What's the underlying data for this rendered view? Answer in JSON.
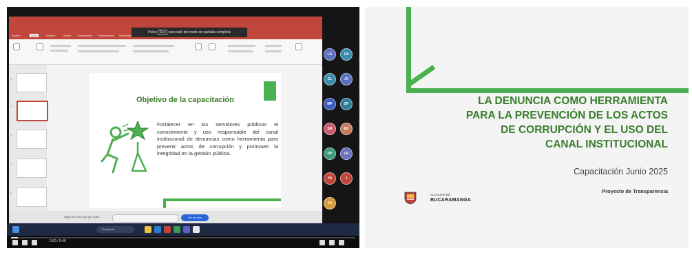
{
  "call": {
    "notice_prefix": "Pulse",
    "notice_key": "Esc",
    "notice_suffix": "para salir del modo de pantalla completa",
    "elapsed_time": "0:00 / 0:46",
    "progress_fraction": 0.02
  },
  "powerpoint": {
    "tabs": [
      "Archivo",
      "Inicio",
      "Insertar",
      "Diseño",
      "Transiciones",
      "Animaciones",
      "Presentación",
      "Revisar",
      "Vista"
    ],
    "accent": "#c0453a",
    "zoom_hint": "Haga clic para agregar notas",
    "button_label": "Ver en vivo",
    "search_placeholder": "Búsqueda"
  },
  "slide": {
    "title": "Objetivo de la capacitación",
    "body": "Fortalecer en los servidores públicos el conocimiento y uso responsable del canal institucional de denuncias como herramienta para prevenir actos de corrupción y promover la integridad en la gestión pública.",
    "slide_numbers": [
      "1",
      "2",
      "3",
      "4",
      "5"
    ]
  },
  "participants": [
    {
      "initials": "LG",
      "color": "#5b6fbf"
    },
    {
      "initials": "LN",
      "color": "#3a8bb0"
    },
    {
      "initials": "CL",
      "color": "#3a8bb0"
    },
    {
      "initials": "JV",
      "color": "#5b6fbf"
    },
    {
      "initials": "MP",
      "color": "#3b5bbf"
    },
    {
      "initials": "SF",
      "color": "#2e7d9b"
    },
    {
      "initials": "SR",
      "color": "#c85a6a"
    },
    {
      "initials": "ED",
      "color": "#c87a5a"
    },
    {
      "initials": "DP",
      "color": "#3a9b7b"
    },
    {
      "initials": "LR",
      "color": "#6b6fbf"
    },
    {
      "initials": "YA",
      "color": "#c0453a"
    },
    {
      "initials": "J",
      "color": "#c0453a"
    },
    {
      "initials": "JA",
      "color": "#d49a3a"
    }
  ],
  "title_slide": {
    "title_lines": [
      "LA DENUNCIA COMO HERRAMIENTA",
      "PARA LA PREVENCIÓN DE LOS ACTOS",
      "DE CORRUPCIÓN Y EL USO DEL",
      "CANAL INSTITUCIONAL"
    ],
    "subtitle": "Capacitación Junio 2025",
    "project": "Proyecto de Transparencia",
    "logo_top": "ALCALDÍA DE",
    "logo_main": "BUCARAMANGA",
    "accent": "#4caf50"
  }
}
